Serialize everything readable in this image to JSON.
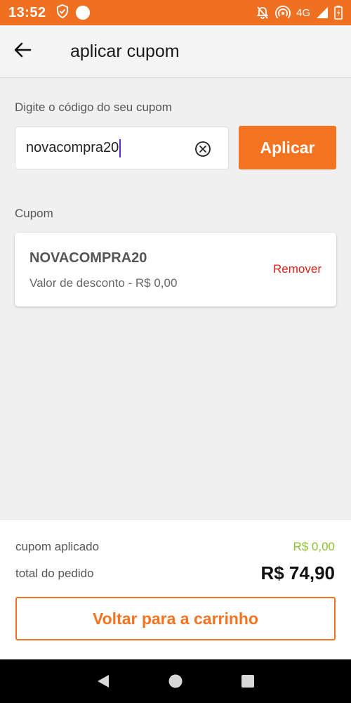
{
  "status_bar": {
    "time": "13:52",
    "network": "4G",
    "icons": [
      "shield-check-icon",
      "circle-icon",
      "mute-notifications-icon",
      "hotspot-icon",
      "signal-icon",
      "battery-icon"
    ]
  },
  "header": {
    "title": "aplicar cupom",
    "back_icon": "arrow-left-icon"
  },
  "coupon_input": {
    "label": "Digite o código do seu cupom",
    "value": "novacompra20",
    "clear_icon": "clear-circle-icon",
    "apply_label": "Aplicar"
  },
  "coupon_section": {
    "label": "Cupom",
    "card": {
      "code": "NOVACOMPRA20",
      "discount": "Valor de desconto - R$ 0,00",
      "remove_label": "Remover"
    }
  },
  "summary": {
    "applied_label": "cupom aplicado",
    "applied_value": "R$ 0,00",
    "total_label": "total do pedido",
    "total_value": "R$ 74,90",
    "back_button_label": "Voltar para a carrinho"
  },
  "nav_bar": {
    "icons": [
      "back-triangle-icon",
      "home-circle-icon",
      "recents-square-icon"
    ]
  },
  "colors": {
    "accent": "#f47320",
    "status_bar": "#f07022",
    "remove": "#d9241c",
    "applied_value": "#8cc034",
    "background": "#f0f0f0"
  }
}
